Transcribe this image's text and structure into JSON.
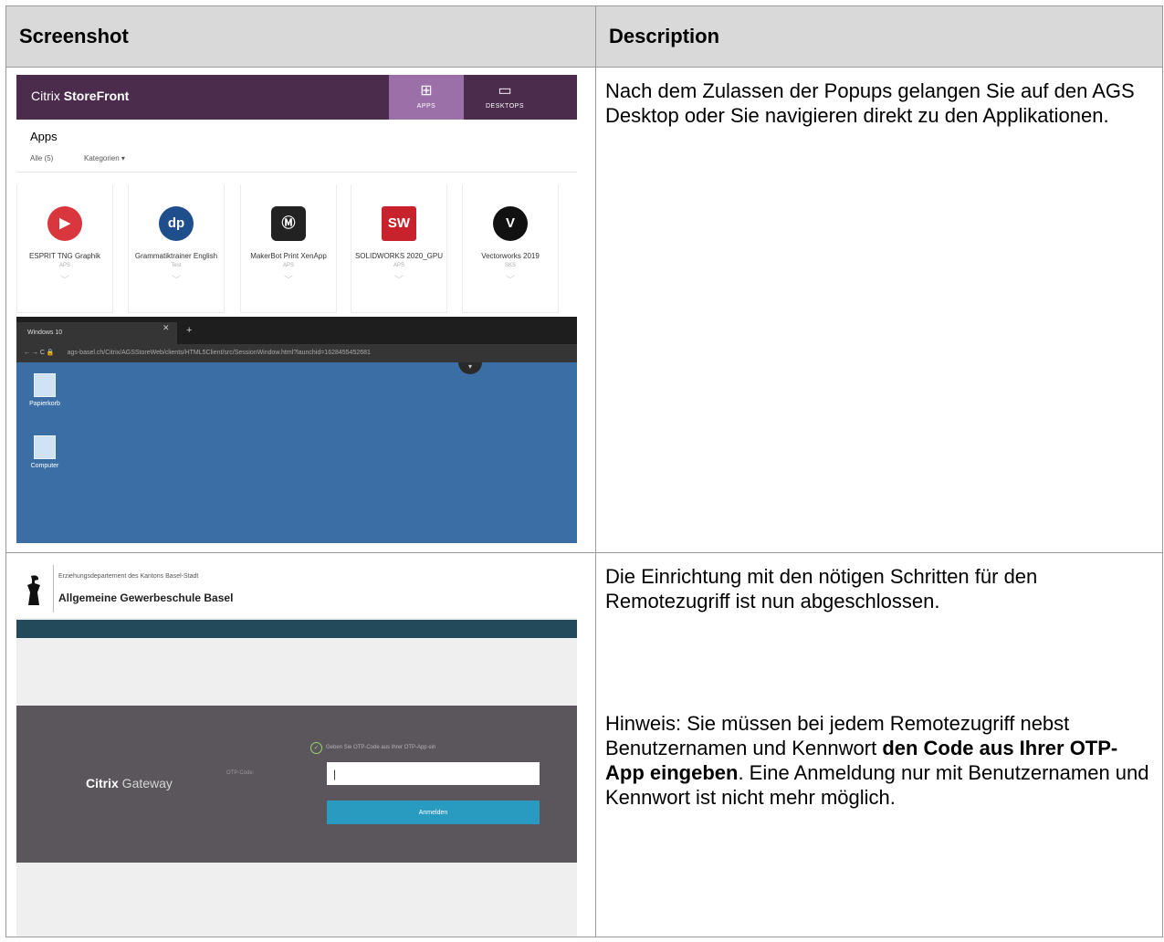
{
  "table": {
    "headers": [
      "Screenshot",
      "Description"
    ],
    "rows": [
      {
        "description": "Nach dem Zulassen der Popups gelangen Sie auf den AGS Desktop oder Sie navigieren direkt zu den Applikationen."
      },
      {
        "description_1": "Die Einrichtung mit den nötigen Schritten für den Remotezugriff ist nun abgeschlossen.",
        "note_prefix": "Hinweis: Sie müssen bei jedem Remotezugriff nebst Benutzernamen und Kennwort ",
        "note_bold": "den Code aus Ihrer OTP-App eingeben",
        "note_suffix": ". Eine Anmeldung nur mit Benutzernamen und Kennwort ist nicht mehr möglich."
      }
    ]
  },
  "storefront": {
    "logo_light": "Citrix ",
    "logo_bold": "StoreFront",
    "tab_apps": "APPS",
    "tab_desktops": "DESKTOPS",
    "tab_apps_icon": "grid-icon",
    "tab_desktops_icon": "monitor-icon",
    "heading": "Apps",
    "filter_all": "Alle (5)",
    "filter_categories": "Kategorien ▾",
    "brand_color": "#4c2c4d",
    "apps": [
      {
        "name": "ESPRIT TNG Graphik",
        "tag": "APS",
        "icon": "esprit-icon",
        "color": "#d9363e",
        "glyph": "▶"
      },
      {
        "name": "Grammatiktrainer English",
        "tag": "Test",
        "icon": "dp-icon",
        "color": "#1f4e8c",
        "glyph": "dp"
      },
      {
        "name": "MakerBot Print XenApp",
        "tag": "APS",
        "icon": "makerbot-icon",
        "color": "#222222",
        "glyph": "Ⓜ"
      },
      {
        "name": "SOLIDWORKS 2020_GPU",
        "tag": "APS",
        "icon": "solidworks-icon",
        "color": "#c8232c",
        "glyph": "SW"
      },
      {
        "name": "Vectorworks 2019",
        "tag": "SKS",
        "icon": "vectorworks-icon",
        "color": "#111111",
        "glyph": "V"
      }
    ]
  },
  "browser": {
    "tab_title": "Windows 10",
    "url": "ags-basel.ch/Citrix/AGSStoreWeb/clients/HTML5Client/src/SessionWindow.html?launchid=1628455452681",
    "url_prefix": "ags-basel.ch",
    "nav": "← → C 🔒",
    "desktop_icons": [
      "Papierkorb",
      "Computer"
    ],
    "desktop_color": "#3a6ea5"
  },
  "gateway": {
    "org": "Erziehungsdepartement des Kantons Basel-Stadt",
    "school": "Allgemeine Gewerbeschule Basel",
    "logo_bold": "Citrix",
    "logo_light": " Gateway",
    "status_msg": "Geben Sie OTP-Code aus Ihrer OTP-App ein",
    "otp_label": "OTP-Code:",
    "input_value": "|",
    "login_button": "Anmelden",
    "bar_color": "#234a5b",
    "button_color": "#2a9bc0"
  }
}
